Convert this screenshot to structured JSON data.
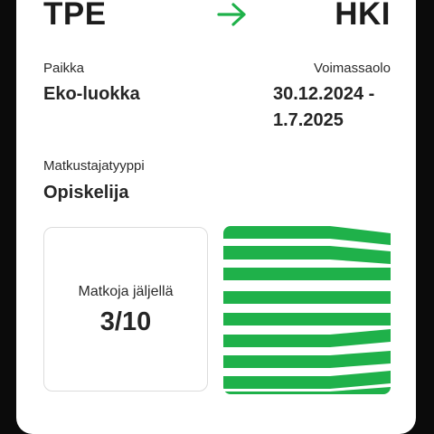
{
  "route": {
    "from": "TPE",
    "to": "HKI",
    "arrow_icon": "arrow-right-icon",
    "accent": "#1fb14a"
  },
  "seat": {
    "label": "Paikka",
    "value": "Eko-luokka"
  },
  "validity": {
    "label": "Voimassaolo",
    "line1": "30.12.2024 -",
    "line2": "1.7.2025"
  },
  "passenger": {
    "label": "Matkustajatyyppi",
    "value": "Opiskelija"
  },
  "trips": {
    "label": "Matkoja jäljellä",
    "value": "3/10"
  },
  "animation": {
    "icon": "green-stripes-validity-animation",
    "color": "#1fb14a"
  }
}
